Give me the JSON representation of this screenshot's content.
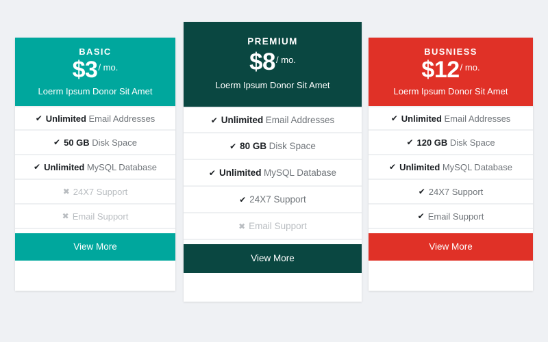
{
  "page": {
    "background_color": "#eff1f4",
    "layout": "three-column-pricing-table"
  },
  "icons": {
    "check": "✔",
    "cross": "✖"
  },
  "plans": [
    {
      "id": "basic",
      "title": "BASIC",
      "price": "$3",
      "period": "/ mo.",
      "tagline": "Loerm Ipsum Donor Sit Amet",
      "accent_color": "#00a79d",
      "header_text_color": "#ffffff",
      "featured": false,
      "features": [
        {
          "strong": "Unlimited",
          "text": "Email Addresses",
          "enabled": true
        },
        {
          "strong": "50 GB",
          "text": "Disk Space",
          "enabled": true
        },
        {
          "strong": "Unlimited",
          "text": "MySQL Database",
          "enabled": true
        },
        {
          "strong": "",
          "text": "24X7 Support",
          "enabled": false
        },
        {
          "strong": "",
          "text": "Email Support",
          "enabled": false
        }
      ],
      "button_label": "View More"
    },
    {
      "id": "premium",
      "title": "PREMIUM",
      "price": "$8",
      "period": "/ mo.",
      "tagline": "Loerm Ipsum Donor Sit Amet",
      "accent_color": "#0a4741",
      "header_text_color": "#ffffff",
      "featured": true,
      "features": [
        {
          "strong": "Unlimited",
          "text": "Email Addresses",
          "enabled": true
        },
        {
          "strong": "80 GB",
          "text": "Disk Space",
          "enabled": true
        },
        {
          "strong": "Unlimited",
          "text": "MySQL Database",
          "enabled": true
        },
        {
          "strong": "",
          "text": "24X7 Support",
          "enabled": true
        },
        {
          "strong": "",
          "text": "Email Support",
          "enabled": false
        }
      ],
      "button_label": "View More"
    },
    {
      "id": "business",
      "title": "BUSNIESS",
      "price": "$12",
      "period": "/ mo.",
      "tagline": "Loerm Ipsum Donor Sit Amet",
      "accent_color": "#e03127",
      "header_text_color": "#ffffff",
      "featured": false,
      "features": [
        {
          "strong": "Unlimited",
          "text": "Email Addresses",
          "enabled": true
        },
        {
          "strong": "120 GB",
          "text": "Disk Space",
          "enabled": true
        },
        {
          "strong": "Unlimited",
          "text": "MySQL Database",
          "enabled": true
        },
        {
          "strong": "",
          "text": "24X7 Support",
          "enabled": true
        },
        {
          "strong": "",
          "text": "Email Support",
          "enabled": true
        }
      ],
      "button_label": "View More"
    }
  ]
}
